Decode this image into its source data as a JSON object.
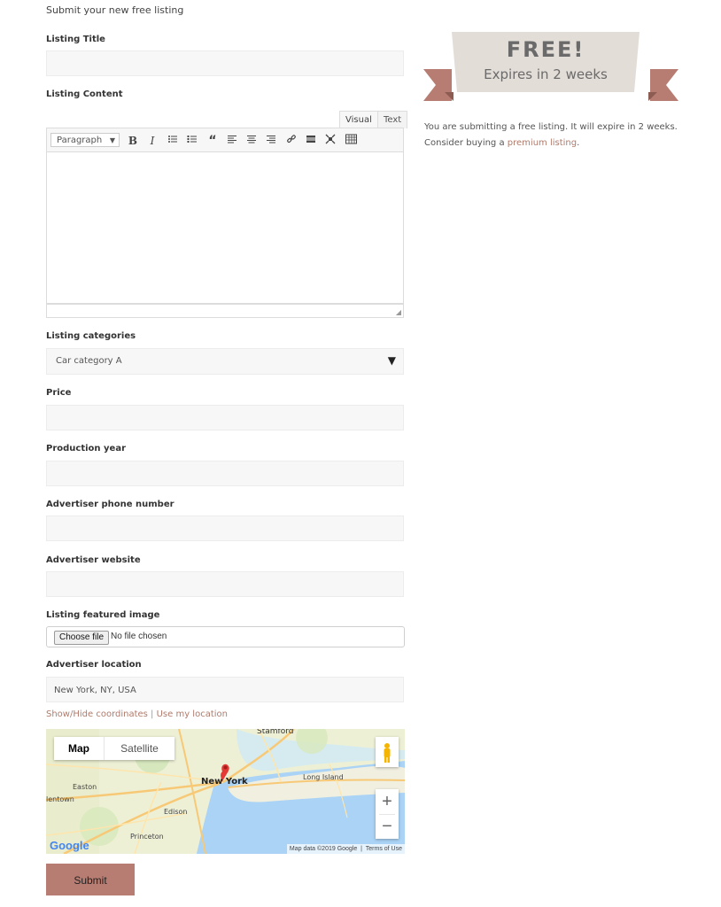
{
  "form": {
    "intro": "Submit your new free listing",
    "title_label": "Listing Title",
    "content_label": "Listing Content",
    "tab_visual": "Visual",
    "tab_text": "Text",
    "format_select": "Paragraph",
    "categories_label": "Listing categories",
    "category_value": "Car category A",
    "price_label": "Price",
    "year_label": "Production year",
    "phone_label": "Advertiser phone number",
    "website_label": "Advertiser website",
    "image_label": "Listing featured image",
    "file_button": "Choose file",
    "file_status": "No file chosen",
    "location_label": "Advertiser location",
    "location_value": "New York, NY, USA",
    "link_coords": "Show/Hide coordinates",
    "link_separator": " | ",
    "link_location": "Use my location",
    "submit": "Submit"
  },
  "map": {
    "tab_map": "Map",
    "tab_satellite": "Satellite",
    "zoom_in": "+",
    "zoom_out": "−",
    "labels": {
      "stamford": "Stamford",
      "new_york": "New York",
      "long_island": "Long Island",
      "easton": "Easton",
      "edison": "Edison",
      "princeton": "Princeton",
      "allentown": "lentown"
    },
    "attribution": "Map data ©2019 Google",
    "terms": "Terms of Use",
    "logo": "Google"
  },
  "sidebar": {
    "banner_title": "FREE!",
    "banner_subtitle": "Expires in 2 weeks",
    "text_before": "You are submitting a free listing. It will expire in 2 weeks. Consider buying a ",
    "premium_link": "premium listing",
    "text_after": "."
  },
  "colors": {
    "accent": "#b87d72",
    "link": "#b07a6a",
    "banner_bg": "#e3ddd7",
    "banner_ribbon": "#b87d72",
    "field_bg": "#f7f7f7"
  }
}
